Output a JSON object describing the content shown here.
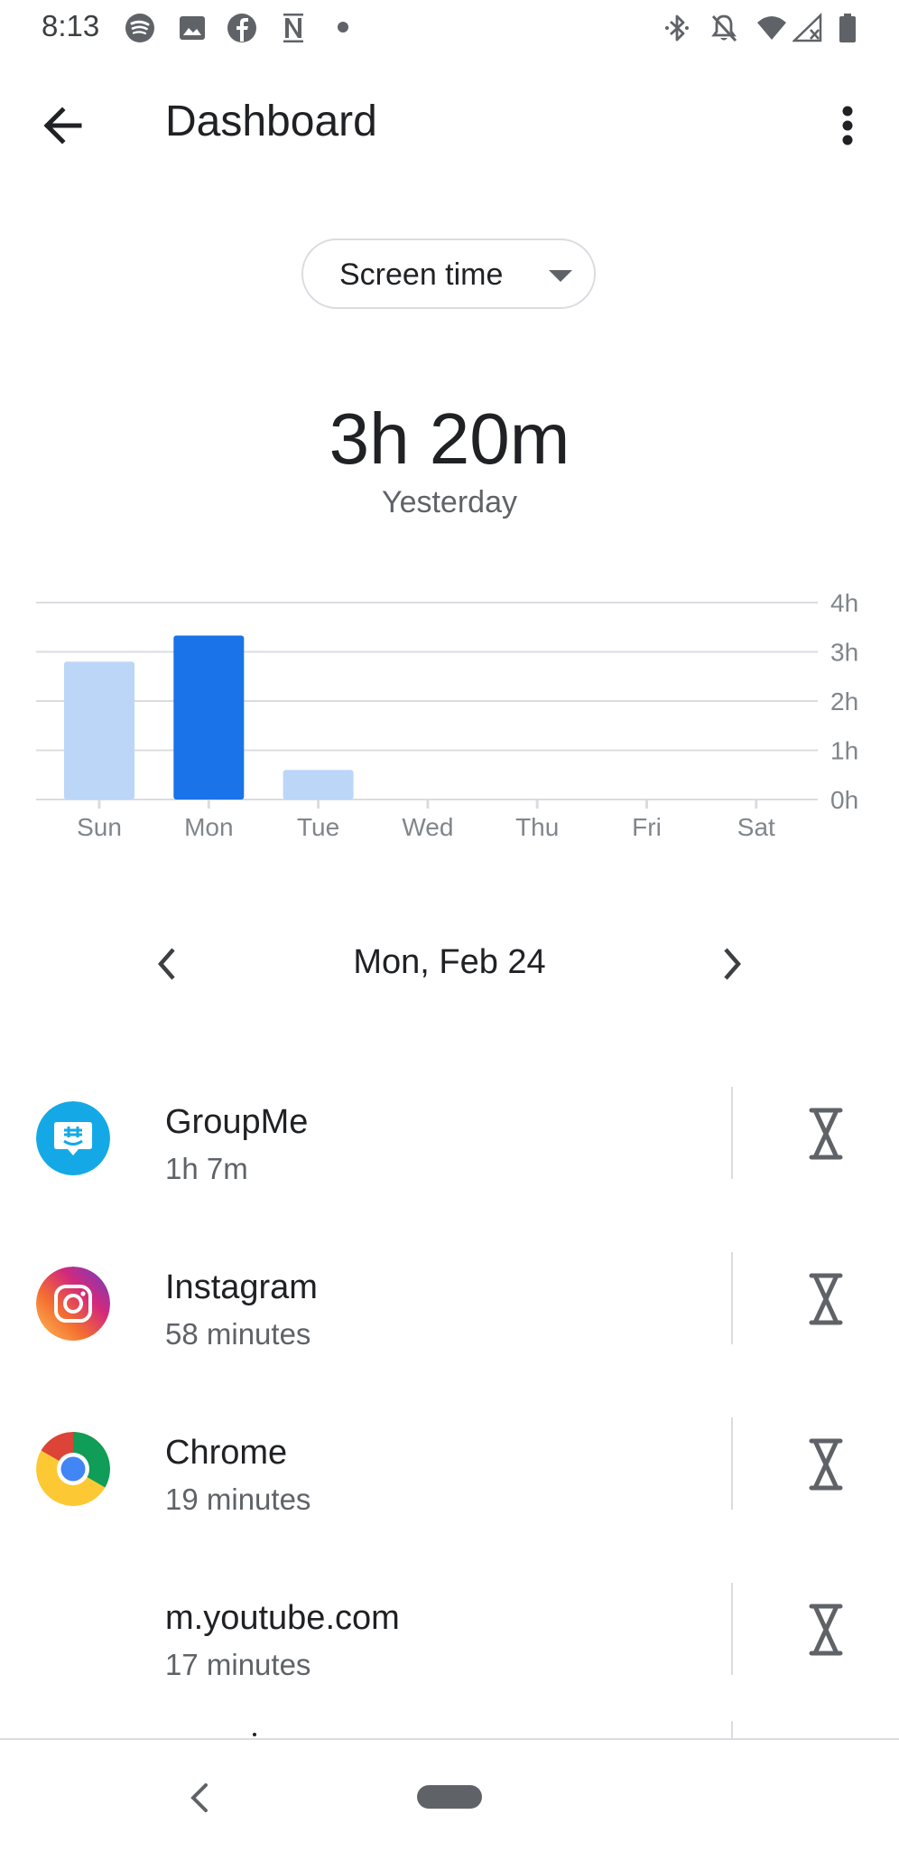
{
  "status_bar": {
    "time": "8:13",
    "left_icons": [
      "spotify-icon",
      "image-icon",
      "facebook-icon",
      "news-icon",
      "dot-icon"
    ],
    "right_icons": [
      "bluetooth-icon",
      "notifications-off-icon",
      "wifi-icon",
      "signal-icon",
      "battery-icon"
    ]
  },
  "app_bar": {
    "title": "Dashboard"
  },
  "metric_dropdown": {
    "selected": "Screen time"
  },
  "summary": {
    "total": "3h 20m",
    "period": "Yesterday"
  },
  "chart_data": {
    "type": "bar",
    "categories": [
      "Sun",
      "Mon",
      "Tue",
      "Wed",
      "Thu",
      "Fri",
      "Sat"
    ],
    "values": [
      2.8,
      3.33,
      0.6,
      0,
      0,
      0,
      0
    ],
    "highlighted_index": 1,
    "y_tick_labels": [
      "4h",
      "3h",
      "2h",
      "1h",
      "0h"
    ],
    "ylim": [
      0,
      4
    ],
    "grid": true,
    "colors": {
      "highlight": "#1a73e8",
      "normal": "#bcd6f8",
      "grid": "#dadce0"
    }
  },
  "date_nav": {
    "label": "Mon, Feb 24"
  },
  "apps": [
    {
      "name": "GroupMe",
      "time": "1h 7m",
      "icon": "groupme-icon"
    },
    {
      "name": "Instagram",
      "time": "58 minutes",
      "icon": "instagram-icon"
    },
    {
      "name": "Chrome",
      "time": "19 minutes",
      "icon": "chrome-icon"
    },
    {
      "name": "m.youtube.com",
      "time": "17 minutes",
      "icon": ""
    }
  ]
}
